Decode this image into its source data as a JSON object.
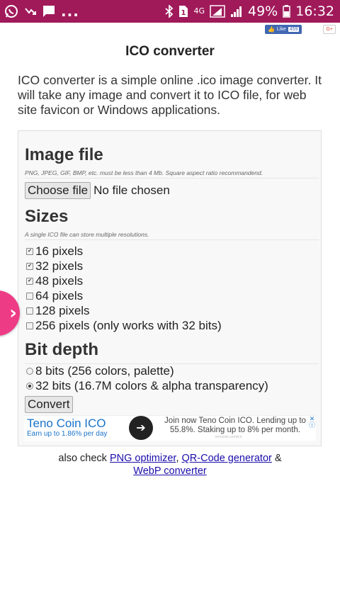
{
  "status_bar": {
    "notif_icons": [
      "whatsapp-icon",
      "missed-call-icon",
      "message-icon"
    ],
    "more": "...",
    "network": "4G",
    "battery": "49%",
    "time": "16:32"
  },
  "social": {
    "fb_like": "Like",
    "fb_count": "459",
    "gplus": "G+"
  },
  "title": "ICO converter",
  "intro": "ICO converter is a simple online .ico image converter. It will take any image and convert it to ICO file, for web site favicon or Windows applications.",
  "form": {
    "image_file": {
      "heading": "Image file",
      "hint": "PNG, JPEG, GIF, BMP, etc. must be less than 4 Mb. Square aspect ratio recommandend.",
      "choose_label": "Choose file",
      "status": "No file chosen"
    },
    "sizes": {
      "heading": "Sizes",
      "hint": "A single ICO file can store multiple resolutions.",
      "options": [
        {
          "label": "16 pixels",
          "checked": true
        },
        {
          "label": "32 pixels",
          "checked": true
        },
        {
          "label": "48 pixels",
          "checked": true
        },
        {
          "label": "64 pixels",
          "checked": false
        },
        {
          "label": "128 pixels",
          "checked": false
        },
        {
          "label": "256 pixels (only works with 32 bits)",
          "checked": false
        }
      ]
    },
    "bit_depth": {
      "heading": "Bit depth",
      "options": [
        {
          "label": "8 bits (256 colors, palette)",
          "selected": false
        },
        {
          "label": "32 bits (16.7M colors & alpha transparency)",
          "selected": true
        }
      ]
    },
    "convert_label": "Convert"
  },
  "ad": {
    "title": "Teno Coin ICO",
    "subtitle": "Earn up to 1.86% per day",
    "text": "Join now Teno Coin ICO. Lending up to 55.8%. Staking up to 8% per month.",
    "domain": "tenocoin.com/ico"
  },
  "footer": {
    "prefix": "also check",
    "link1": "PNG optimizer",
    "link2": "QR-Code generator",
    "amp": "&",
    "link3": "WebP converter"
  },
  "colors": {
    "status_bar": "#a01a5a",
    "side_tab": "#ee3b86",
    "link": "#1a0dab",
    "ad_blue": "#1a73c8"
  }
}
